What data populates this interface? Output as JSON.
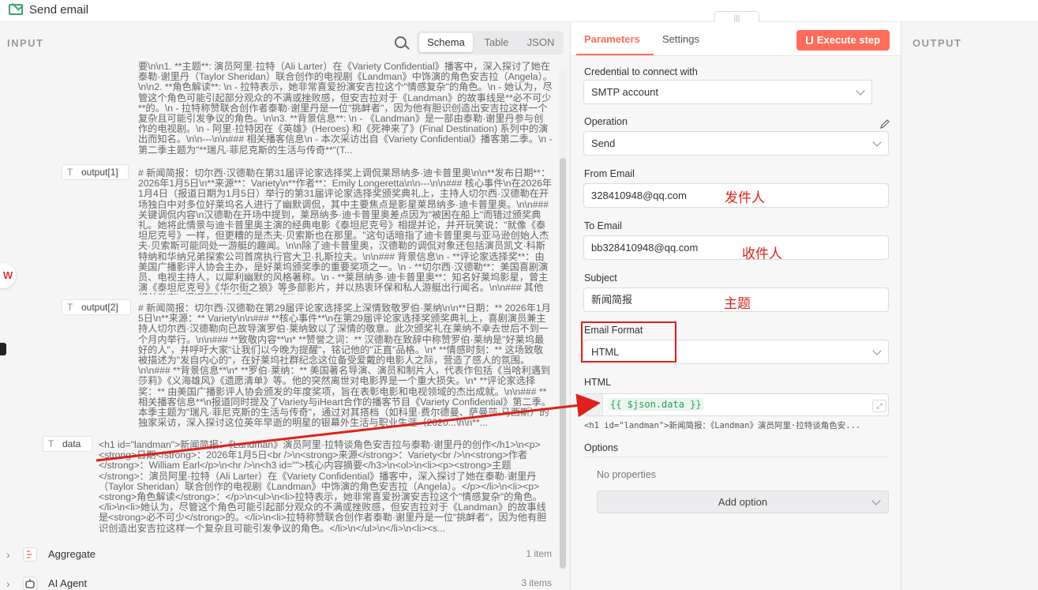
{
  "window": {
    "title": "Send email"
  },
  "input": {
    "label": "INPUT",
    "view_tabs": [
      "Schema",
      "Table",
      "JSON"
    ],
    "text_top": "要\\n\\n1. **主题**: 演员阿里·拉特（Ali Larter）在《Variety Confidential》播客中，深入探讨了她在泰勒·谢里丹（Taylor Sheridan）联合创作的电视剧《Landman》中饰演的角色安吉拉（Angela）。\\n\\n2. **角色解读**: \\n - 拉特表示，她非常喜爱扮演安吉拉这个\"情感复杂\"的角色。\\n - 她认为，尽管这个角色可能引起部分观众的不满或挫败感，但安吉拉对于《Landman》的故事线是**必不可少**的。\\n - 拉特称赞联合创作者泰勒·谢里丹是一位\"挑衅者\"，因为他有胆识创造出安吉拉这样一个复杂且可能引发争议的角色。\\n\\n3. **背景信息**: \\n - 《Landman》是一部由泰勒·谢里丹参与创作的电视剧。\\n - 阿里·拉特因在《英雄》(Heroes) 和《死神来了》(Final Destination) 系列中的演出而知名。\\n\\n---\\n\\n### 相关播客信息\\n - 本次采访出自《Variety Confidential》播客第二季。\\n - 第二季主题为\"**瑞凡·菲尼克斯的生活与传奇**\"(T...",
    "output1": {
      "label": "output[1]",
      "text": "# 新闻简报：切尔西·汉德勒在第31届评论家选择奖上调侃莱昂纳多·迪卡普里奥\\n\\n**发布日期**：2026年1月5日\\n**来源**：Variety\\n**作者**：Emily Longeretta\\n\\n---\\n\\n### 核心事件\\n在2026年1月4日（报道日期为1月5日）举行的第31届评论家选择奖颁奖典礼上，主持人切尔西·汉德勒在开场独白中对多位好莱坞名人进行了幽默调侃，其中主要焦点是影星莱昂纳多·迪卡普里奥。\\n\\n### 关键调侃内容\\n汉德勒在开场中提到，莱昂纳多·迪卡普里奥差点因为\"被困在船上\"而错过颁奖典礼。她将此情景与迪卡普里奥主演的经典电影《泰坦尼克号》相提并论，并开玩笑说：\"就像《泰坦尼克号》一样，但更糟的是杰夫·贝索斯也在那里。\"这句话暗指了迪卡普里奥与亚马逊创始人杰夫·贝索斯可能同处一游艇的趣闻。\\n\\n除了迪卡普里奥，汉德勒的调侃对象还包括演员凯文·科斯特纳和华纳兄弟探索公司首席执行官大卫·扎斯拉夫。\\n\\n### 背景信息\\n - **评论家选择奖**：由美国广播影评人协会主办，是好莱坞颁奖季的重要奖项之一。\\n - **切尔西·汉德勒**：美国喜剧演员、电视主持人，以犀利幽默的风格著称。\\n - **莱昂纳多·迪卡普里奥**：知名好莱坞影星，曾主演《泰坦尼克号》《华尔街之狼》等多部影片，并以热衷环保和私人游艇出行闻名。\\n\\n### 其他相关动态\\n报道同时推广了Variety与iHea..."
    },
    "output2": {
      "label": "output[2]",
      "text": "# 新闻简报：切尔西·汉德勒在第29届评论家选择奖上深情致敬罗伯·莱纳\\n\\n**日期：** 2026年1月5日\\n**来源：** Variety\\n\\n### **核心事件**\\n在第29届评论家选择奖颁奖典礼上，喜剧演员兼主持人切尔西·汉德勒向已故导演罗伯·莱纳致以了深情的敬意。此次颁奖礼在莱纳不幸去世后不到一个月内举行。\\n\\n### **致敬内容**\\n* **赞誉之词：** 汉德勒在致辞中称赞罗伯·莱纳是\"好莱坞最好的人\"，并呼吁大家\"让我们以今晚为提醒\"，铭记他的\"正直\"品格。\\n* **情感时刻：** 这场致敬被描述为\"发自内心的\"，在好莱坞社群纪念这位备受爱戴的电影人之际，营造了感人的氛围。\\n\\n### **背景信息**\\n* **罗伯·莱纳：** 美国著名导演、演员和制片人，代表作包括《当哈利遇到莎莉》《义海雄风》《遗愿清单》等。他的突然离世对电影界是一个重大损失。\\n* **评论家选择奖：** 由美国广播影评人协会颁发的年度奖项，旨在表彰电影和电视领域的杰出成就。\\n\\n### **相关播客信息**\\n报道同时提及了Variety与iHeart合作的播客节目《Variety Confidential》第二季。本季主题为\"瑞凡·菲尼克斯的生活与传奇\"，通过对其搭档（如科里·费尔德曼、萨曼莎·马西斯）的独家采访，深入探讨这位英年早逝的明星的银幕外生活与职业生涯（2020...\\n\\n**..."
    },
    "data": {
      "label": "data",
      "text": "<h1 id=\"landman\">新闻简报：《Landman》演员阿里·拉特谈角色安吉拉与泰勒·谢里丹的创作</h1>\\n<p><strong>日期</strong>：2026年1月5日<br />\\n<strong>来源</strong>：Variety<br />\\n<strong>作者</strong>：William Earl</p>\\n<hr />\\n<h3 id=\"\">核心内容摘要</h3>\\n<ol>\\n<li><p><strong>主题</strong>：演员阿里·拉特（Ali Larter）在《Variety Confidential》播客中，深入探讨了她在泰勒·谢里丹（Taylor Sheridan）联合创作的电视剧《Landman》中饰演的角色安吉拉（Angela）。</p></li>\\n<li><p><strong>角色解读</strong>：</p>\\n<ul>\\n<li>拉特表示，她非常喜爱扮演安吉拉这个\"情感复杂\"的角色。</li>\\n<li>她认为，尽管这个角色可能引起部分观众的不满或挫败感，但安吉拉对于《Landman》的故事线是<strong>必不可少</strong>的。</li>\\n<li>拉特称赞联合创作者泰勒·谢里丹是一位\"挑衅者\"，因为他有胆识创造出安吉拉这样一个复杂且可能引发争议的角色。</li>\\n</ul>\\n</li>\\n<li><s..."
    },
    "nodes": [
      {
        "name": "Aggregate",
        "count": "1 item"
      },
      {
        "name": "AI Agent",
        "count": "3 items"
      }
    ]
  },
  "params": {
    "tabs": [
      "Parameters",
      "Settings"
    ],
    "execute_label": "Execute step",
    "credential_label": "Credential to connect with",
    "credential_value": "SMTP account",
    "operation_label": "Operation",
    "operation_value": "Send",
    "from_label": "From Email",
    "from_value": "328410948@qq.com",
    "from_anno": "发件人",
    "to_label": "To Email",
    "to_value": "bb328410948@qq.com",
    "to_anno": "收件人",
    "subject_label": "Subject",
    "subject_value": "新闻简报",
    "subject_anno": "主题",
    "format_label": "Email Format",
    "format_value": "HTML",
    "html_label": "HTML",
    "html_fx": "fx",
    "html_expr": "{{ $json.data }}",
    "html_preview": "<h1 id=\"landman\">新闻简报：《Landman》演员阿里·拉特谈角色安...",
    "options_label": "Options",
    "no_props": "No properties",
    "add_option": "Add option"
  },
  "output": {
    "label": "OUTPUT"
  },
  "colors": {
    "accent": "#ff6d5a",
    "annotation": "#e0201a",
    "expression": "#2f9e5a"
  }
}
